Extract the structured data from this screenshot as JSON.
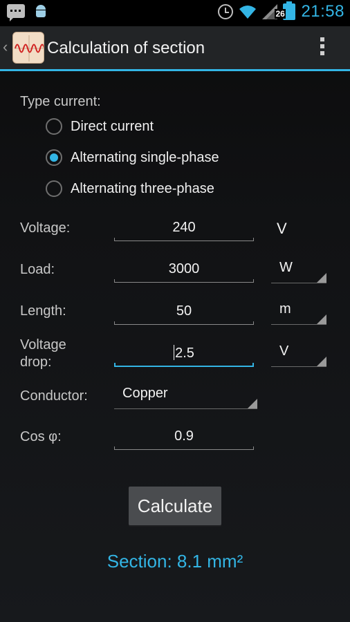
{
  "status_bar": {
    "icons_left": [
      "chat-icon",
      "android-icon"
    ],
    "icons_right": [
      "alarm-clock-icon",
      "wifi-icon",
      "signal-icon",
      "battery-icon"
    ],
    "battery_level": "26",
    "time": "21:58"
  },
  "action_bar": {
    "title": "Calculation of section",
    "app_icon": "waveform-icon",
    "overflow_icon": "overflow-menu-icon"
  },
  "form": {
    "type_current": {
      "label": "Type current:",
      "options": [
        {
          "label": "Direct current",
          "checked": false
        },
        {
          "label": "Alternating single-phase",
          "checked": true
        },
        {
          "label": "Alternating three-phase",
          "checked": false
        }
      ]
    },
    "voltage": {
      "label": "Voltage:",
      "value": "240",
      "unit": "V"
    },
    "load": {
      "label": "Load:",
      "value": "3000",
      "unit": "W"
    },
    "length": {
      "label": "Length:",
      "value": "50",
      "unit": "m"
    },
    "voltage_drop": {
      "label_line1": "Voltage",
      "label_line2": "drop:",
      "value": "2.5",
      "unit": "V"
    },
    "conductor": {
      "label": "Conductor:",
      "value": "Copper"
    },
    "cos_phi": {
      "label": "Cos φ:",
      "value": "0.9"
    }
  },
  "calculate_button": "Calculate",
  "result": "Section: 8.1 mm²",
  "colors": {
    "accent": "#33b5e5",
    "background": "#111214"
  }
}
